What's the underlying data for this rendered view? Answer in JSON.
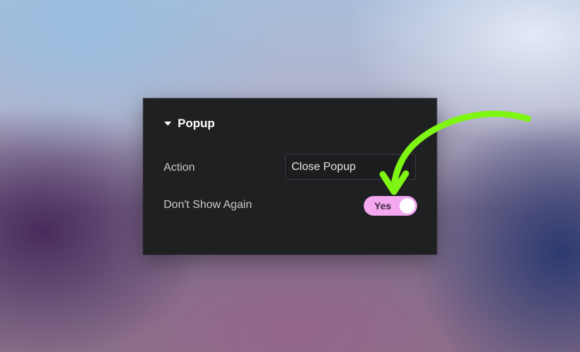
{
  "panel": {
    "section_title": "Popup",
    "action": {
      "label": "Action",
      "value": "Close Popup"
    },
    "dont_show_again": {
      "label": "Don't Show Again",
      "toggle_text": "Yes",
      "toggle_on": true
    }
  },
  "icons": {
    "section_caret": "caret-down-icon",
    "annotation": "curved-arrow-icon"
  },
  "colors": {
    "panel_bg": "#1f2022",
    "toggle_on": "#f4a8f0",
    "annotation_arrow": "#7ff514"
  }
}
